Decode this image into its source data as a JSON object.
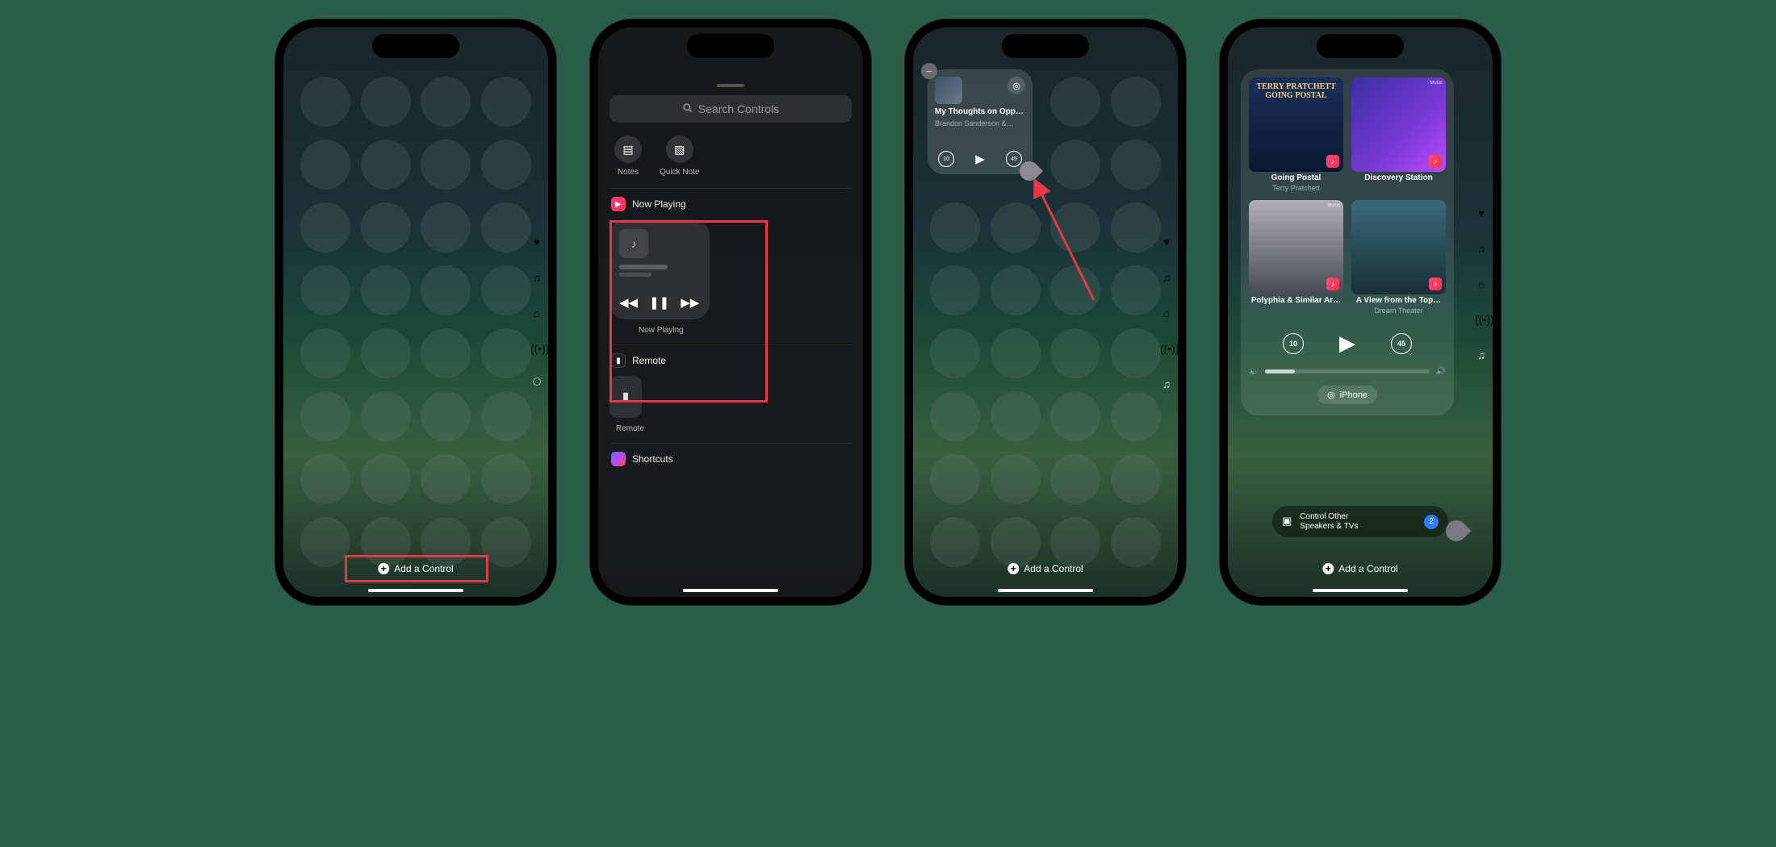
{
  "phone1": {
    "bottom_button": "Add a Control"
  },
  "phone2": {
    "search_placeholder": "Search Controls",
    "suggestions": [
      {
        "label": "Notes"
      },
      {
        "label": "Quick Note"
      }
    ],
    "now_playing_section": "Now Playing",
    "now_playing_caption": "Now Playing",
    "remote_section": "Remote",
    "remote_caption": "Remote",
    "shortcuts_section": "Shortcuts"
  },
  "phone3": {
    "widget_title": "My Thoughts on Opp…",
    "widget_subtitle": "Brandon Sanderson &…",
    "skip_back": "10",
    "skip_fwd": "45",
    "bottom_button": "Add a Control"
  },
  "phone4": {
    "albums": [
      {
        "title": "Going Postal",
        "subtitle": "Terry Pratchett"
      },
      {
        "title": "Discovery Station",
        "subtitle": ""
      },
      {
        "title": "Polyphia & Similar Ar…",
        "subtitle": ""
      },
      {
        "title": "A View from the Top…",
        "subtitle": "Dream Theater"
      }
    ],
    "skip_back": "10",
    "skip_fwd": "45",
    "airplay_device": "iPhone",
    "control_other_line1": "Control Other",
    "control_other_line2": "Speakers & TVs",
    "control_other_count": "2",
    "bottom_button": "Add a Control"
  }
}
